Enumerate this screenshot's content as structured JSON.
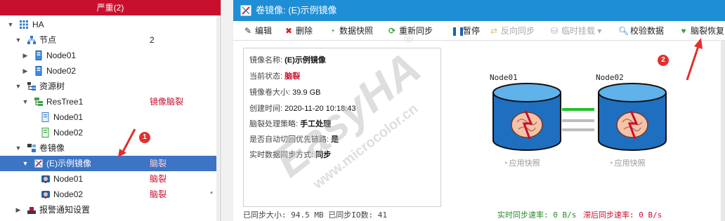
{
  "left_panel": {
    "header": "严重(2)",
    "tree": [
      {
        "label": "HA"
      },
      {
        "label": "节点",
        "count": "2"
      },
      {
        "label": "Node01"
      },
      {
        "label": "Node02"
      },
      {
        "label": "资源树"
      },
      {
        "label": "ResTree1",
        "status": "镜像脑裂"
      },
      {
        "label": "Node01"
      },
      {
        "label": "Node02"
      },
      {
        "label": "卷镜像"
      },
      {
        "label": "(E)示例镜像",
        "status": "脑裂"
      },
      {
        "label": "Node01",
        "status": "脑裂"
      },
      {
        "label": "Node02",
        "status": "脑裂",
        "star": "*"
      },
      {
        "label": "报警通知设置"
      }
    ]
  },
  "right_panel": {
    "title": "卷镜像: (E)示例镜像",
    "toolbar": [
      {
        "label": "编辑",
        "icon": "edit-icon"
      },
      {
        "label": "删除",
        "icon": "delete-icon"
      },
      {
        "label": "数据快照",
        "icon": "snapshot-icon"
      },
      {
        "label": "重新同步",
        "icon": "resync-icon"
      },
      {
        "label": "暂停",
        "icon": "pause-icon"
      },
      {
        "label": "反向同步",
        "icon": "reverse-sync-icon"
      },
      {
        "label": "临时挂载 ▾",
        "icon": "mount-icon"
      },
      {
        "label": "校验数据",
        "icon": "verify-icon"
      },
      {
        "label": "脑裂恢复",
        "icon": "splitbrain-recover-icon"
      }
    ],
    "info": {
      "name_label": "镜像名称:",
      "name_value": "(E)示例镜像",
      "state_label": "当前状态:",
      "state_value": "脑裂",
      "size_label": "镜像卷大小:",
      "size_value": "39.9 GB",
      "created_label": "创建时间:",
      "created_value": "2020-11-20 10:18:43",
      "policy_label": "脑裂处理策略:",
      "policy_value": "手工处理",
      "failover_label": "是否自动切回优先链路:",
      "failover_value": "是",
      "sync_mode_label": "实时数据同步方式:",
      "sync_mode_value": "同步"
    },
    "diagram": {
      "node1": "Node01",
      "node2": "Node02",
      "apply_snapshot_1": "应用快照",
      "apply_snapshot_2": "应用快照"
    },
    "footer": {
      "synced": "已同步大小: 94.5 MB 已同步IO数: 41",
      "realtime_rate": "实时同步速率: 0 B/s",
      "lag_rate": "滞后同步速率: 0 B/s"
    }
  },
  "watermark": {
    "brand": "EasyHA",
    "site": "www.microcolor.cn",
    "reg": "®"
  },
  "annotations": {
    "badge1": "1",
    "badge2": "2"
  },
  "colors": {
    "critical": "#c8102e",
    "title_bar": "#1e8ed6",
    "selected_row": "#3d74c4",
    "sync_green": "#2a8c2a"
  }
}
